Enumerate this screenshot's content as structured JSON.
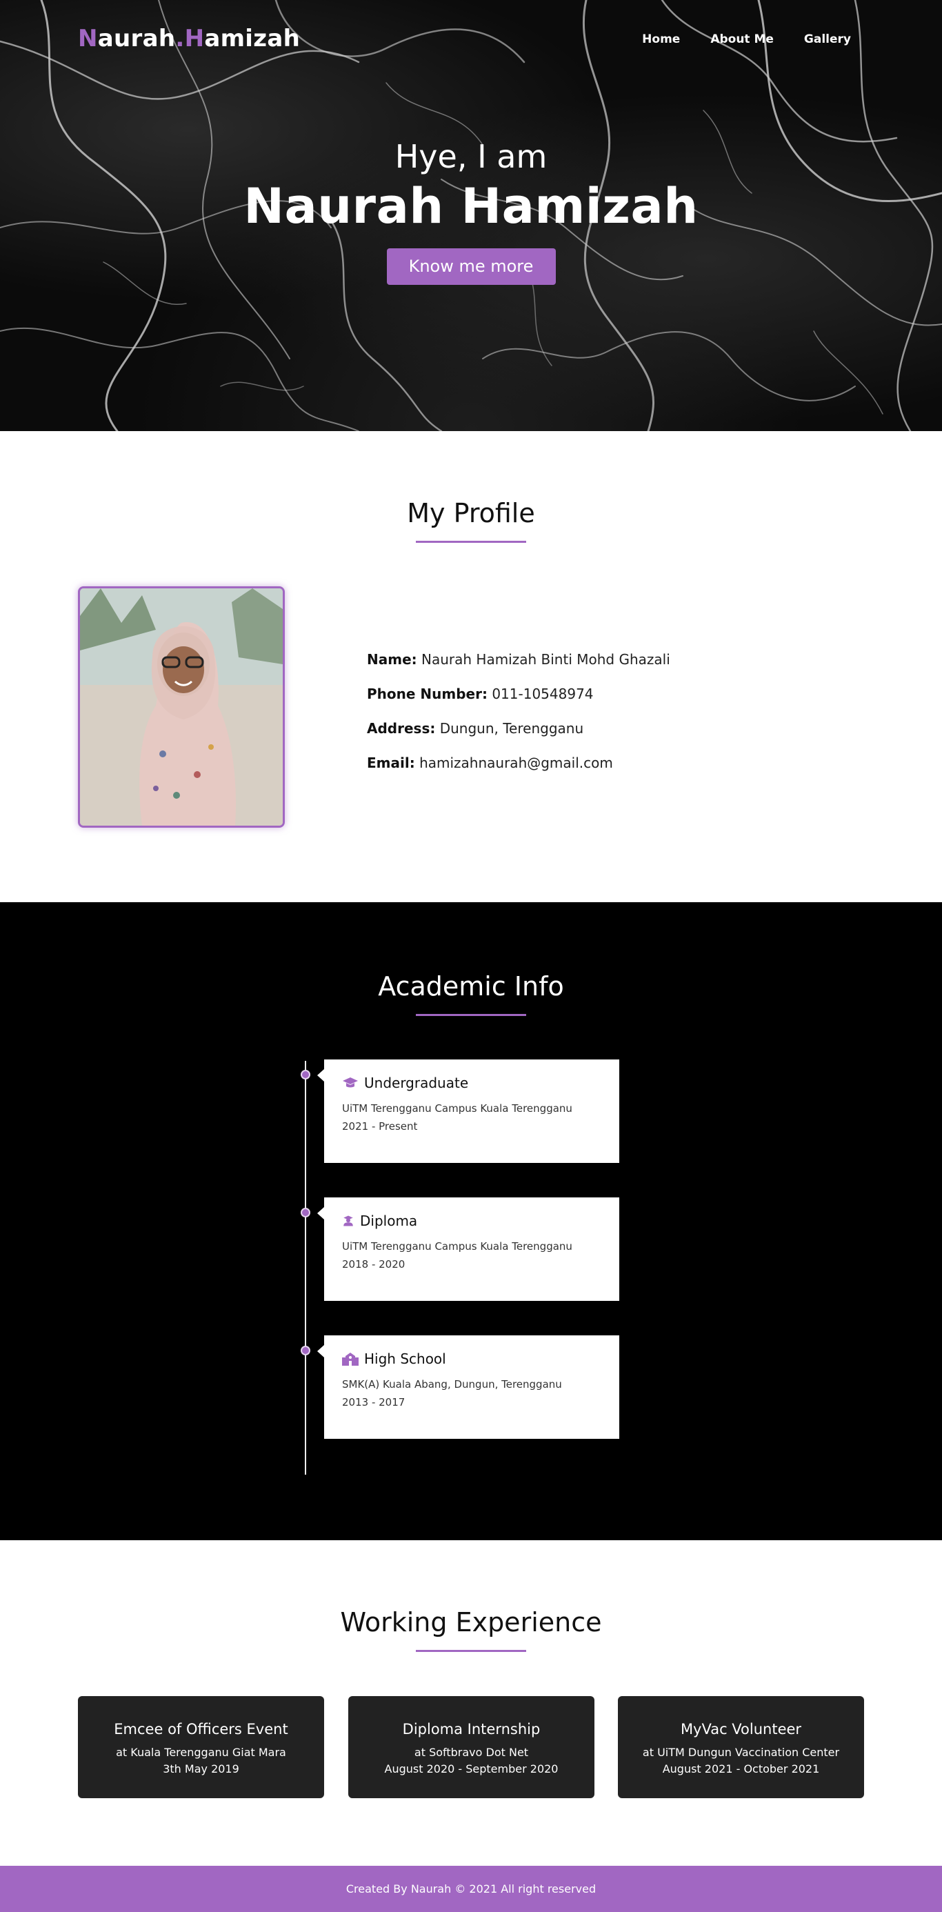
{
  "nav": {
    "logo": {
      "first_initial": "N",
      "first_rest": "aurah",
      "dot": ".",
      "last_initial": "H",
      "last_rest": "amizah"
    },
    "links": [
      "Home",
      "About Me",
      "Gallery"
    ]
  },
  "hero": {
    "greeting": "Hye, I am",
    "name": "Naurah Hamizah",
    "button": "Know me more"
  },
  "profile": {
    "title": "My Profile",
    "fields": [
      {
        "label": "Name:",
        "value": "Naurah Hamizah Binti Mohd Ghazali"
      },
      {
        "label": "Phone Number:",
        "value": "011-10548974"
      },
      {
        "label": "Address:",
        "value": "Dungun, Terengganu"
      },
      {
        "label": "Email:",
        "value": "hamizahnaurah@gmail.com"
      }
    ]
  },
  "academic": {
    "title": "Academic Info",
    "items": [
      {
        "icon": "graduation-cap-icon",
        "title": "Undergraduate",
        "place": "UiTM Terengganu Campus Kuala Terengganu",
        "years": "2021 - Present"
      },
      {
        "icon": "user-graduate-icon",
        "title": "Diploma",
        "place": "UiTM Terengganu Campus Kuala Terengganu",
        "years": "2018 - 2020"
      },
      {
        "icon": "school-icon",
        "title": "High School",
        "place": "SMK(A) Kuala Abang, Dungun, Terengganu",
        "years": "2013 - 2017"
      }
    ]
  },
  "work": {
    "title": "Working Experience",
    "items": [
      {
        "title": "Emcee of Officers Event",
        "place": "at Kuala Terengganu Giat Mara",
        "date": "3th May 2019"
      },
      {
        "title": "Diploma Internship",
        "place": "at Softbravo Dot Net",
        "date": "August 2020 - September 2020"
      },
      {
        "title": "MyVac Volunteer",
        "place": "at UiTM Dungun Vaccination Center",
        "date": "August 2021 - October 2021"
      }
    ]
  },
  "footer": {
    "text": "Created By Naurah © 2021 All right reserved"
  },
  "colors": {
    "accent": "#a167c2",
    "dark": "#000000",
    "card_dark": "#222222"
  }
}
